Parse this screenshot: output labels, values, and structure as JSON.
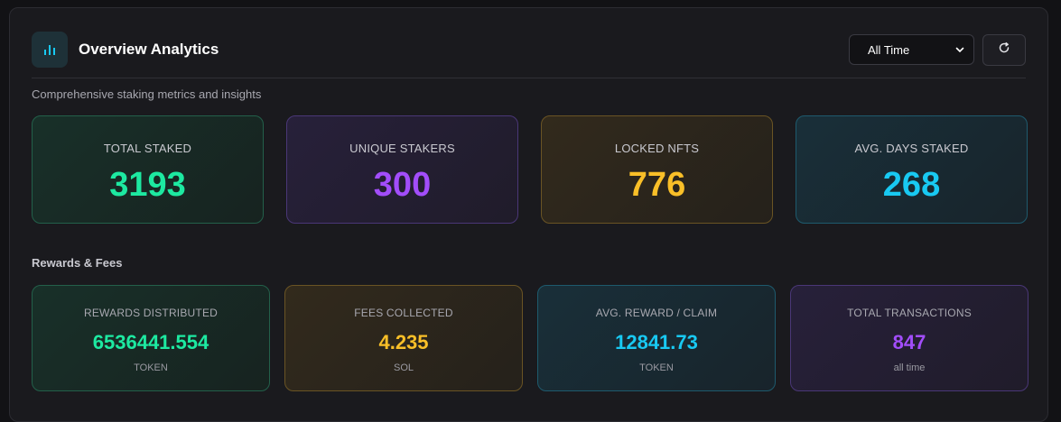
{
  "header": {
    "title": "Overview Analytics",
    "subtitle": "Comprehensive staking metrics and insights",
    "time_filter": {
      "selected": "All Time"
    },
    "icons": {
      "logo": "bar-chart-icon",
      "dropdown": "chevron-down-icon",
      "refresh": "refresh-icon"
    }
  },
  "stats": [
    {
      "label": "TOTAL STAKED",
      "value": "3193",
      "color": "#1de9a1"
    },
    {
      "label": "UNIQUE STAKERS",
      "value": "300",
      "color": "#a24dfa"
    },
    {
      "label": "LOCKED NFTS",
      "value": "776",
      "color": "#f9bf28"
    },
    {
      "label": "AVG. DAYS STAKED",
      "value": "268",
      "color": "#18c9f2"
    }
  ],
  "rewards": {
    "title": "Rewards & Fees",
    "cards": [
      {
        "label": "REWARDS DISTRIBUTED",
        "value": "6536441.554",
        "unit": "TOKEN",
        "color": "#1de9a1"
      },
      {
        "label": "FEES COLLECTED",
        "value": "4.235",
        "unit": "SOL",
        "color": "#f9bf28"
      },
      {
        "label": "AVG. REWARD / CLAIM",
        "value": "12841.73",
        "unit": "TOKEN",
        "color": "#18c9f2"
      },
      {
        "label": "TOTAL TRANSACTIONS",
        "value": "847",
        "unit": "all time",
        "color": "#a24dfa"
      }
    ]
  },
  "colors": {
    "accent": "#18c9f2",
    "background": "#1a1a1e"
  }
}
